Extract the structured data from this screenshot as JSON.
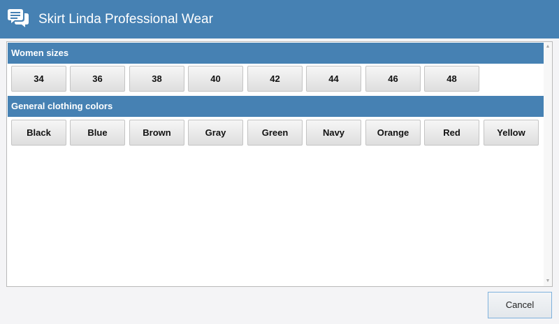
{
  "window": {
    "title": "Skirt Linda Professional Wear",
    "icon": "chat-bubbles-icon",
    "accent_color": "#4681b3"
  },
  "sections": {
    "sizes": {
      "header": "Women sizes",
      "options": [
        "34",
        "36",
        "38",
        "40",
        "42",
        "44",
        "46",
        "48"
      ]
    },
    "colors": {
      "header": "General clothing colors",
      "options": [
        "Black",
        "Blue",
        "Brown",
        "Gray",
        "Green",
        "Navy",
        "Orange",
        "Red",
        "Yellow"
      ]
    }
  },
  "footer": {
    "cancel_label": "Cancel"
  }
}
